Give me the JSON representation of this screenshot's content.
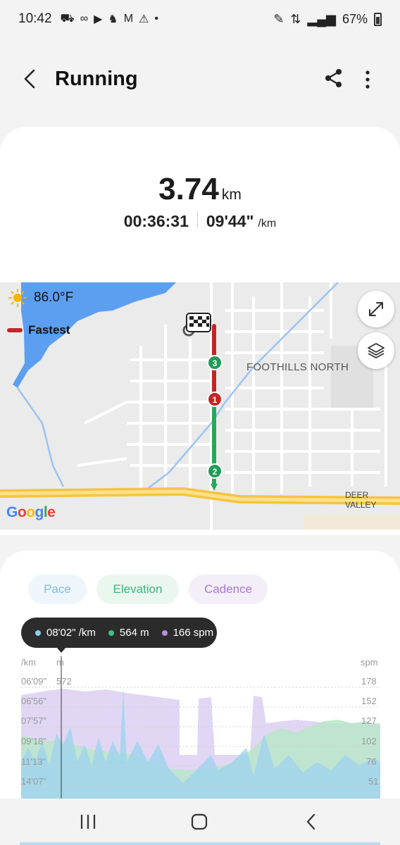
{
  "status_bar": {
    "time": "10:42",
    "battery": "67%"
  },
  "app_bar": {
    "title": "Running"
  },
  "summary": {
    "distance": "3.74",
    "distance_unit": "km",
    "duration": "00:36:31",
    "pace": "09'44\"",
    "pace_unit": "/km"
  },
  "map": {
    "weather": "86.0°F",
    "legend_label": "Fastest",
    "area_label": "FOOTHILLS NORTH",
    "road_label": "DEER VALLEY",
    "attribution": "Google",
    "markers": [
      "3",
      "1",
      "2"
    ]
  },
  "chart": {
    "tabs": {
      "pace": "Pace",
      "elevation": "Elevation",
      "cadence": "Cadence"
    },
    "tooltip": {
      "pace": "08'02\" /km",
      "elevation": "564 m",
      "cadence": "166 spm"
    },
    "axis_units": {
      "left_pace": "/km",
      "left_elev": "m",
      "right": "spm"
    },
    "pace_ticks": [
      "06'09\"",
      "06'56\"",
      "07'57\"",
      "09'18\"",
      "11'13\"",
      "14'07\""
    ],
    "elev_ticks": [
      "572"
    ],
    "cadence_ticks": [
      "178",
      "152",
      "127",
      "102",
      "76",
      "51"
    ],
    "colors": {
      "pace": "#8fcbeb",
      "elevation": "#44c07f",
      "cadence": "#b48ee0"
    }
  }
}
